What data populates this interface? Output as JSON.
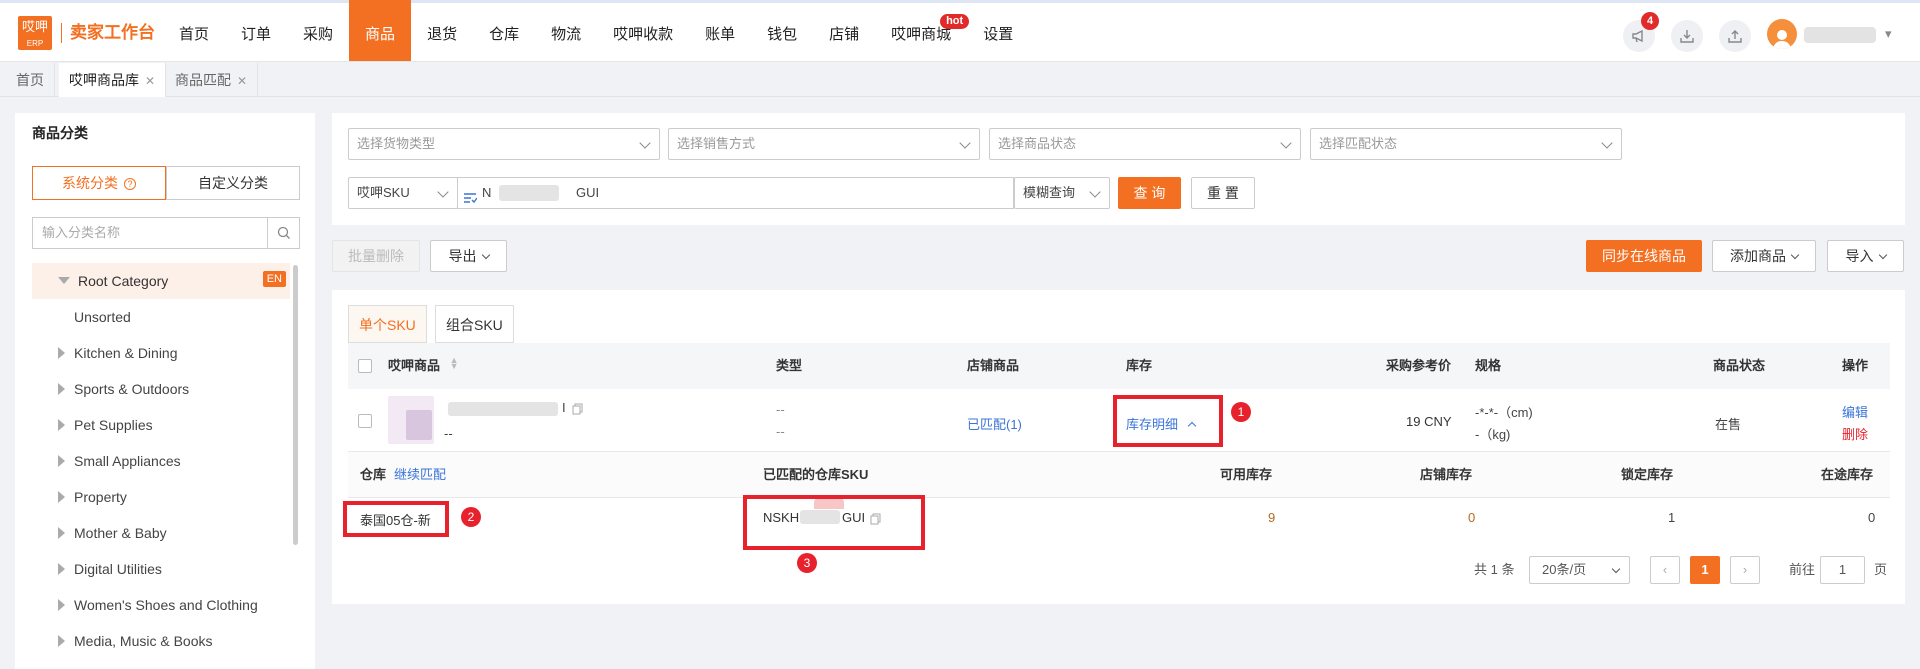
{
  "topbar": {
    "logo_text": "哎呷",
    "logo_sub": "ERP",
    "app_title": "卖家工作台",
    "nav": [
      {
        "label": "首页"
      },
      {
        "label": "订单"
      },
      {
        "label": "采购"
      },
      {
        "label": "商品",
        "active": true
      },
      {
        "label": "退货"
      },
      {
        "label": "仓库"
      },
      {
        "label": "物流"
      },
      {
        "label": "哎呷收款"
      },
      {
        "label": "账单"
      },
      {
        "label": "钱包"
      },
      {
        "label": "店铺"
      },
      {
        "label": "哎呷商城",
        "badge": "hot"
      },
      {
        "label": "设置"
      }
    ],
    "notification_count": "4",
    "icons": [
      "megaphone-icon",
      "download-icon",
      "upload-icon",
      "user-avatar"
    ]
  },
  "page_tabs": [
    {
      "label": "首页"
    },
    {
      "label": "哎呷商品库",
      "closable": true,
      "active": true
    },
    {
      "label": "商品匹配",
      "closable": true
    }
  ],
  "left": {
    "title": "商品分类",
    "seg_system": "系统分类",
    "seg_custom": "自定义分类",
    "search_placeholder": "输入分类名称",
    "root": "Root Category",
    "root_tag": "EN",
    "categories": [
      "Unsorted",
      "Kitchen & Dining",
      "Sports & Outdoors",
      "Pet Supplies",
      "Small Appliances",
      "Property",
      "Mother & Baby",
      "Digital Utilities",
      "Women's Shoes and Clothing",
      "Media, Music & Books"
    ]
  },
  "filters": {
    "goods_type": "选择货物类型",
    "sale_mode": "选择销售方式",
    "goods_status": "选择商品状态",
    "match_status": "选择匹配状态",
    "search_field": "哎呷SKU",
    "search_value_prefix": "N",
    "search_value_suffix": "GUI",
    "match_mode": "模糊查询",
    "query_btn": "查 询",
    "reset_btn": "重 置"
  },
  "toolbar": {
    "batch_delete": "批量删除",
    "export": "导出",
    "sync": "同步在线商品",
    "add": "添加商品",
    "import": "导入"
  },
  "sku_tabs": [
    "单个SKU",
    "组合SKU"
  ],
  "table": {
    "headers": {
      "product": "哎呷商品",
      "type": "类型",
      "shop_goods": "店铺商品",
      "stock": "库存",
      "price": "采购参考价",
      "spec": "规格",
      "status": "商品状态",
      "action": "操作"
    },
    "row": {
      "name_suffix": "I",
      "sub": "--",
      "type1": "--",
      "type2": "--",
      "matched": "已匹配(1)",
      "stock_detail": "库存明细",
      "price": "19 CNY",
      "spec1": "-*-*-（cm)",
      "spec2": "-（kg)",
      "status": "在售",
      "edit": "编辑",
      "delete": "删除"
    }
  },
  "stock_sub": {
    "headers": {
      "warehouse": "仓库",
      "continue": "继续匹配",
      "sku": "已匹配的仓库SKU",
      "available": "可用库存",
      "shop": "店铺库存",
      "locked": "锁定库存",
      "transit": "在途库存"
    },
    "row": {
      "warehouse": "泰国05仓-新",
      "sku_prefix": "NSKH",
      "sku_suffix": "GUI",
      "available": "9",
      "shop": "0",
      "locked": "1",
      "transit": "0"
    }
  },
  "annotations": [
    "1",
    "2",
    "3"
  ],
  "pagination": {
    "total": "共 1 条",
    "page_size": "20条/页",
    "current": "1",
    "goto_label": "前往",
    "goto_value": "1",
    "page_unit": "页"
  },
  "colors": {
    "accent": "#f36f21",
    "link": "#3b74d9",
    "danger": "#e8222c"
  }
}
